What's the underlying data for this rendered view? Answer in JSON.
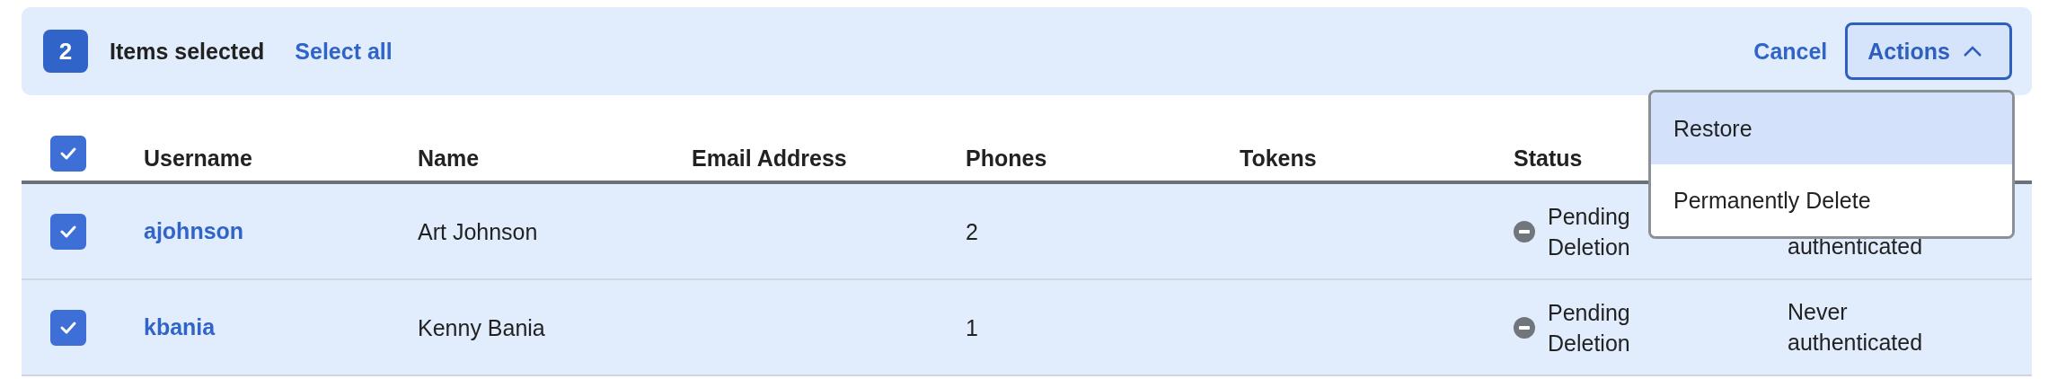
{
  "selection_bar": {
    "count": "2",
    "label": "Items selected",
    "select_all": "Select all",
    "cancel": "Cancel",
    "actions": "Actions",
    "actions_expanded": true
  },
  "actions_menu": [
    {
      "label": "Restore",
      "selected": true
    },
    {
      "label": "Permanently Delete",
      "selected": false
    }
  ],
  "table": {
    "all_checked": true,
    "columns": [
      "Username",
      "Name",
      "Email Address",
      "Phones",
      "Tokens",
      "Status"
    ],
    "rows": [
      {
        "checked": true,
        "username": "ajohnson",
        "name": "Art Johnson",
        "email": "",
        "phones": "2",
        "tokens": "",
        "status": [
          "Pending",
          "Deletion"
        ],
        "column_7": [
          "authenticated"
        ]
      },
      {
        "checked": true,
        "username": "kbania",
        "name": "Kenny Bania",
        "email": "",
        "phones": "1",
        "tokens": "",
        "status": [
          "Pending",
          "Deletion"
        ],
        "column_7": [
          "Never",
          "authenticated"
        ]
      }
    ]
  }
}
